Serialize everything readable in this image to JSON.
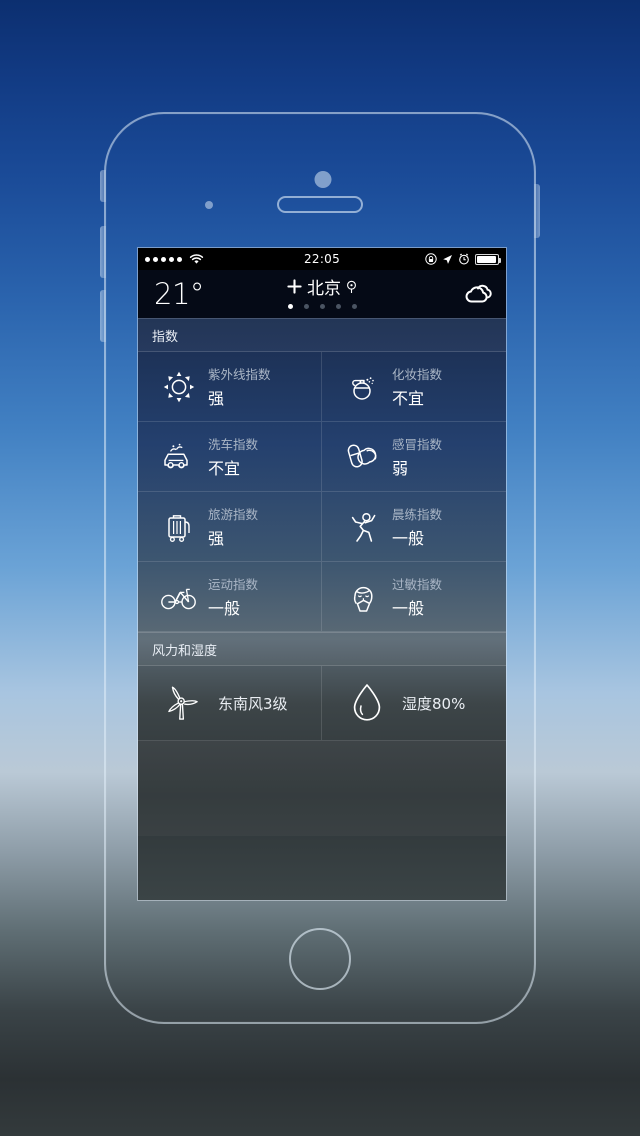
{
  "status_bar": {
    "signal_dots": 5,
    "wifi_icon": "wifi-icon",
    "time": "22:05",
    "rotation_lock_icon": "rotation-lock-icon",
    "location_icon": "location-arrow-icon",
    "alarm_icon": "alarm-clock-icon",
    "battery_icon": "battery-icon"
  },
  "header": {
    "temperature": "21°",
    "add_icon": "plus-icon",
    "city": "北京",
    "pin_icon": "location-pin-icon",
    "page_count": 5,
    "active_page": 1,
    "weather_icon": "cloud-icon"
  },
  "sections": [
    {
      "title": "指数",
      "items": [
        {
          "icon": "sun-icon",
          "label": "紫外线指数",
          "value": "强"
        },
        {
          "icon": "perfume-icon",
          "label": "化妆指数",
          "value": "不宜"
        },
        {
          "icon": "car-wash-icon",
          "label": "洗车指数",
          "value": "不宜"
        },
        {
          "icon": "pills-icon",
          "label": "感冒指数",
          "value": "弱"
        },
        {
          "icon": "suitcase-icon",
          "label": "旅游指数",
          "value": "强"
        },
        {
          "icon": "exercise-icon",
          "label": "晨练指数",
          "value": "一般"
        },
        {
          "icon": "bicycle-icon",
          "label": "运动指数",
          "value": "一般"
        },
        {
          "icon": "sneeze-icon",
          "label": "过敏指数",
          "value": "一般"
        }
      ]
    },
    {
      "title": "风力和湿度",
      "items": [
        {
          "icon": "windmill-icon",
          "value": "东南风3级"
        },
        {
          "icon": "waterdrop-icon",
          "value": "湿度80%"
        }
      ]
    }
  ],
  "colors": {
    "screen_top": "#13233f",
    "screen_bottom": "#3b4446",
    "header_bg": "#050a16",
    "label": "#aab6c6",
    "value": "#ffffff",
    "frame_stroke": "rgba(225,238,250,.55)"
  }
}
